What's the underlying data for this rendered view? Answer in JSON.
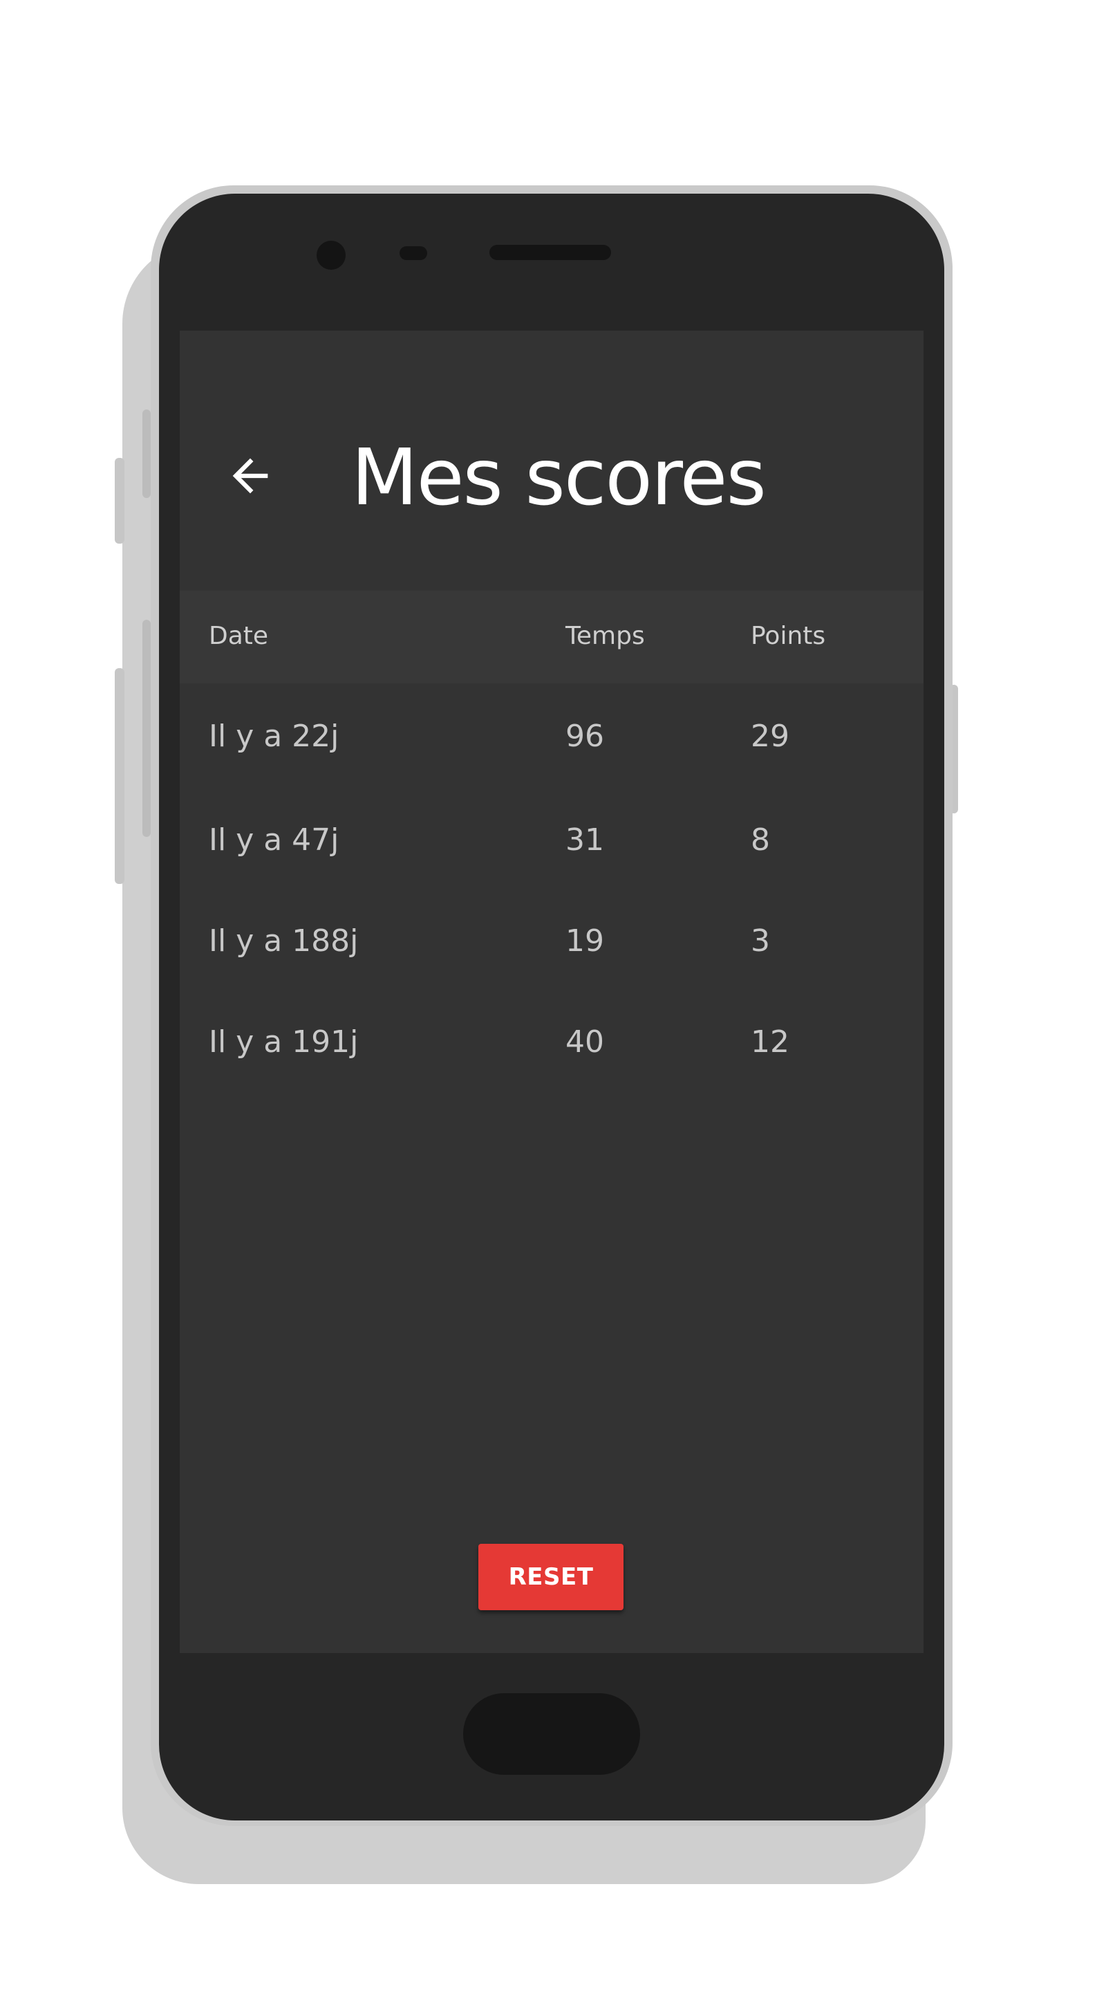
{
  "app": {
    "title": "Mes scores"
  },
  "toolbar": {
    "back_icon": "arrow-left-icon"
  },
  "table": {
    "columns": [
      "Date",
      "Temps",
      "Points"
    ],
    "rows": [
      {
        "date": "Il y a 22j",
        "temps": "96",
        "points": "29"
      },
      {
        "date": "Il y a 47j",
        "temps": "31",
        "points": "8"
      },
      {
        "date": "Il y a 188j",
        "temps": "19",
        "points": "3"
      },
      {
        "date": "Il y a 191j",
        "temps": "40",
        "points": "12"
      }
    ]
  },
  "actions": {
    "reset_label": "RESET"
  },
  "colors": {
    "screen_background": "#333333",
    "header_background": "#383838",
    "accent": "#e53935",
    "text_primary": "#ffffff",
    "text_secondary": "#c8c8c8"
  }
}
